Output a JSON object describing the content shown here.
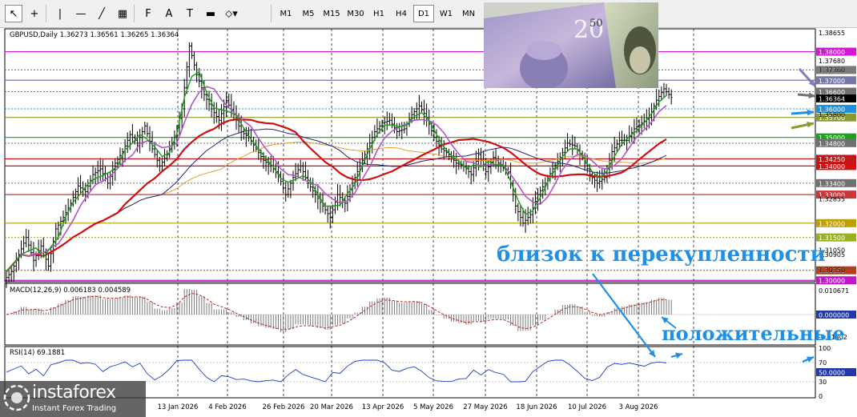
{
  "toolbar": {
    "timeframes": [
      "M1",
      "M5",
      "M15",
      "M30",
      "H1",
      "H4",
      "D1",
      "W1",
      "MN"
    ],
    "active_timeframe": "D1",
    "tools": [
      {
        "name": "cursor-icon",
        "glyph": "↖"
      },
      {
        "name": "crosshair-icon",
        "glyph": "+"
      },
      {
        "name": "vertical-line-icon",
        "glyph": "|"
      },
      {
        "name": "horizontal-line-icon",
        "glyph": "—"
      },
      {
        "name": "trendline-icon",
        "glyph": "╱"
      },
      {
        "name": "channel-icon",
        "glyph": "▦"
      },
      {
        "name": "fibonacci-icon",
        "glyph": "F"
      },
      {
        "name": "text-icon",
        "glyph": "A"
      },
      {
        "name": "label-icon",
        "glyph": "T"
      },
      {
        "name": "rectangle-icon",
        "glyph": "▬"
      },
      {
        "name": "arrows-icon",
        "glyph": "⬦▾"
      }
    ]
  },
  "logo": {
    "name": "instaforex",
    "tagline": "Instant Forex Trading"
  },
  "annotations": {
    "overbought": "близок к перекупленности",
    "positive": "положительные"
  },
  "colors": {
    "price_bar": "#000000",
    "sma_green": "#18a018",
    "sma_violet": "#b455c8",
    "ma_red": "#d01010",
    "ma_navy": "#23237a",
    "ma_orange": "#e0a030",
    "arrow_blue": "#1e90e8"
  },
  "chart_data": {
    "type": "ohlc",
    "symbol_header": "GBPUSD,Daily  1.36273 1.36561 1.36265 1.36364",
    "last_price": "1.36364",
    "ylim": [
      1.2995,
      1.388
    ],
    "x_tick_labels": [
      "13 Jan 2026",
      "4 Feb 2026",
      "26 Feb 2026",
      "20 Mar 2026",
      "13 Apr 2026",
      "5 May 2026",
      "27 May 2026",
      "18 Jun 2026",
      "10 Jul 2026",
      "3 Aug 2026"
    ],
    "price_axis_labels": [
      1.38655,
      1.3768,
      1.3736,
      1.358,
      1.32855,
      1.3105,
      1.30905,
      1.3035
    ],
    "levels": [
      {
        "value": "1.38000",
        "color": "#d218d2",
        "style": "solid"
      },
      {
        "value": "1.37360",
        "color": "#7a7a7a",
        "style": "dotted"
      },
      {
        "value": "1.37000",
        "color": "#7878a8",
        "style": "solid"
      },
      {
        "value": "1.36600",
        "color": "#707070",
        "style": "dotted"
      },
      {
        "value": "1.36000",
        "color": "#2090d8",
        "style": "dotted"
      },
      {
        "value": "1.35700",
        "color": "#8a9a30",
        "style": "solid"
      },
      {
        "value": "1.35000",
        "color": "#1ea01e",
        "style": "solid"
      },
      {
        "value": "1.34800",
        "color": "#707070",
        "style": "dotted"
      },
      {
        "value": "1.34250",
        "color": "#c01818",
        "style": "solid"
      },
      {
        "value": "1.34000",
        "color": "#d01010",
        "style": "solid"
      },
      {
        "value": "1.33400",
        "color": "#707070",
        "style": "dotted"
      },
      {
        "value": "1.33000",
        "color": "#c83838",
        "style": "solid"
      },
      {
        "value": "1.32000",
        "color": "#c0a000",
        "style": "solid"
      },
      {
        "value": "1.31500",
        "color": "#9ab020",
        "style": "dotted"
      },
      {
        "value": "1.30350",
        "color": "#b04020",
        "style": "dotted"
      },
      {
        "value": "1.30000",
        "color": "#c018c8",
        "style": "solid"
      }
    ],
    "ohlc_close_approx": [
      1.303,
      1.309,
      1.315,
      1.307,
      1.312,
      1.305,
      1.318,
      1.322,
      1.327,
      1.333,
      1.331,
      1.337,
      1.339,
      1.334,
      1.341,
      1.345,
      1.351,
      1.348,
      1.354,
      1.346,
      1.34,
      1.344,
      1.35,
      1.36,
      1.382,
      1.372,
      1.365,
      1.36,
      1.356,
      1.363,
      1.358,
      1.352,
      1.35,
      1.346,
      1.342,
      1.34,
      1.337,
      1.33,
      1.336,
      1.34,
      1.334,
      1.33,
      1.326,
      1.322,
      1.33,
      1.327,
      1.334,
      1.34,
      1.346,
      1.352,
      1.355,
      1.356,
      1.352,
      1.353,
      1.358,
      1.361,
      1.357,
      1.35,
      1.346,
      1.344,
      1.341,
      1.34,
      1.337,
      1.344,
      1.338,
      1.343,
      1.34,
      1.338,
      1.326,
      1.32,
      1.323,
      1.33,
      1.334,
      1.339,
      1.343,
      1.348,
      1.347,
      1.343,
      1.337,
      1.334,
      1.336,
      1.345,
      1.349,
      1.349,
      1.353,
      1.355,
      1.357,
      1.363,
      1.367,
      1.364
    ],
    "macd": {
      "header": "MACD(12,26,9) 0.006183 0.004589",
      "axis_labels": [
        "0.010671",
        "0.000000",
        "-0.01302"
      ]
    },
    "rsi": {
      "header": "RSI(14) 69.1881",
      "axis_labels": [
        "100",
        "70",
        "50.0000",
        "30",
        "0"
      ],
      "value": 69.19,
      "ylim": [
        0,
        100
      ]
    }
  }
}
